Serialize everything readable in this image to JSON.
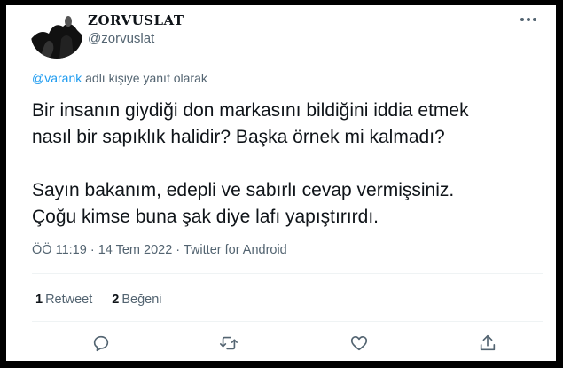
{
  "user": {
    "display_name": "ZORVUSLAT",
    "handle": "@zorvuslat"
  },
  "reply_context": {
    "mention": "@varank",
    "suffix": " adlı kişiye yanıt olarak"
  },
  "tweet": {
    "paragraph_1_line_1": "Bir insanın giydiği don markasını bildiğini iddia etmek",
    "paragraph_1_line_2": "nasıl bir sapıklık halidir? Başka örnek mi kalmadı?",
    "paragraph_2_line_1": "Sayın bakanım, edepli ve sabırlı cevap vermişsiniz.",
    "paragraph_2_line_2": "Çoğu kimse buna şak diye lafı yapıştırırdı."
  },
  "meta": {
    "time": "ÖÖ 11:19",
    "separator": " · ",
    "date": "14 Tem 2022",
    "source": "Twitter for Android"
  },
  "stats": {
    "retweets_count": "1",
    "retweets_label": "Retweet",
    "likes_count": "2",
    "likes_label": "Beğeni"
  },
  "icons": {
    "reply": "comment-icon",
    "retweet": "retweet-icon",
    "like": "heart-icon",
    "share": "share-icon",
    "more": "more-icon"
  },
  "colors": {
    "text": "#0f1419",
    "secondary": "#536471",
    "accent": "#1d9bf0",
    "frame": "#000000"
  }
}
